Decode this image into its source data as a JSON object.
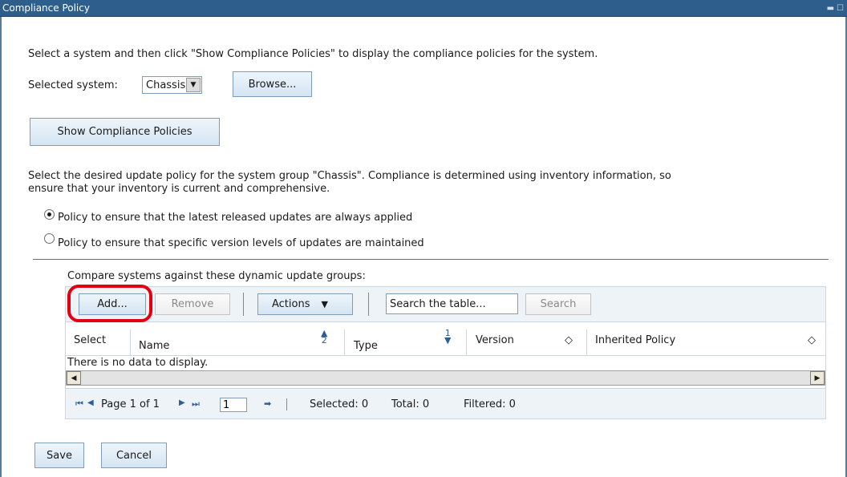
{
  "window": {
    "title": "Compliance Policy",
    "controls": [
      "minimize-icon",
      "restore-icon"
    ]
  },
  "intro_text": "Select a system and then click \"Show Compliance Policies\" to display the compliance policies for the system.",
  "selected_system": {
    "label": "Selected system:",
    "value": "Chassis",
    "browse_label": "Browse..."
  },
  "show_button_label": "Show Compliance Policies",
  "policy_text_line1": "Select the desired update policy for the system group \"Chassis\". Compliance is determined using inventory information, so",
  "policy_text_line2": "ensure that your inventory is current and comprehensive.",
  "policies": [
    {
      "label": "Policy to ensure that the latest released updates are always applied",
      "selected": true
    },
    {
      "label": "Policy to ensure that specific version levels of updates are maintained",
      "selected": false
    }
  ],
  "groups_caption": "Compare systems against these dynamic update groups:",
  "toolbar": {
    "add_label": "Add...",
    "remove_label": "Remove",
    "actions_label": "Actions",
    "search_placeholder": "Search the table...",
    "search_label": "Search"
  },
  "table": {
    "columns": [
      "Select",
      "Name",
      "Type",
      "Version",
      "Inherited Policy"
    ],
    "sort": {
      "name": "2",
      "type": "1"
    },
    "empty_message": "There is no data to display."
  },
  "pager": {
    "page_label": "Page 1 of 1",
    "page_value": "1",
    "selected": "Selected: 0",
    "total": "Total: 0",
    "filtered": "Filtered: 0"
  },
  "footer": {
    "save_label": "Save",
    "cancel_label": "Cancel"
  },
  "colors": {
    "title_bar": "#2e5f8c",
    "highlight": "#e3000f",
    "toolbar_bg": "#eef3f8"
  }
}
